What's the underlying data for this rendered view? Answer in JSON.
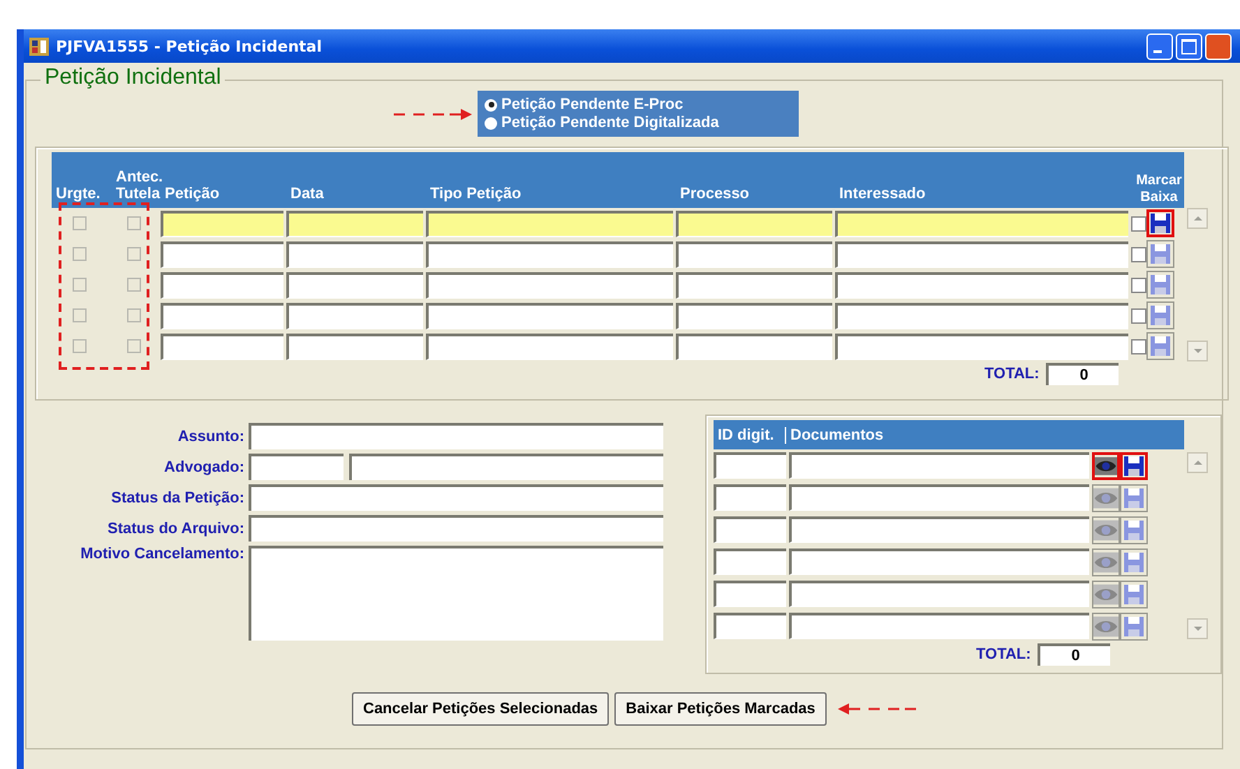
{
  "window": {
    "title": "PJFVA1555 - Petição Incidental"
  },
  "group": {
    "title": "Petição Incidental"
  },
  "radio_options": [
    {
      "label": "Petição Pendente E-Proc",
      "selected": true
    },
    {
      "label": "Petição Pendente Digitalizada",
      "selected": false
    }
  ],
  "petitions": {
    "columns": [
      "Urgte.",
      "Antec. Tutela",
      "Petição",
      "Data",
      "Tipo Petição",
      "Processo",
      "Interessado",
      "Marcar Baixa"
    ],
    "rows": [
      {
        "urgent": false,
        "tutela": false,
        "marked": false,
        "current": true
      },
      {
        "urgent": false,
        "tutela": false,
        "marked": false,
        "current": false
      },
      {
        "urgent": false,
        "tutela": false,
        "marked": false,
        "current": false
      },
      {
        "urgent": false,
        "tutela": false,
        "marked": false,
        "current": false
      },
      {
        "urgent": false,
        "tutela": false,
        "marked": false,
        "current": false
      }
    ],
    "total_label": "TOTAL:",
    "total": "0"
  },
  "details": [
    {
      "label": "Assunto:",
      "kind": "text"
    },
    {
      "label": "Advogado:",
      "kind": "split"
    },
    {
      "label": "Status da Petição:",
      "kind": "text"
    },
    {
      "label": "Status do Arquivo:",
      "kind": "text"
    },
    {
      "label": "Motivo Cancelamento:",
      "kind": "area"
    }
  ],
  "documents": {
    "columns": [
      "ID digit.",
      "Documentos"
    ],
    "rows": [
      {
        "current": true
      },
      {
        "current": false
      },
      {
        "current": false
      },
      {
        "current": false
      },
      {
        "current": false
      },
      {
        "current": false
      }
    ],
    "total_label": "TOTAL:",
    "total": "0"
  },
  "buttons": [
    "Cancelar Petições Selecionadas",
    "Baixar Petições Marcadas"
  ]
}
